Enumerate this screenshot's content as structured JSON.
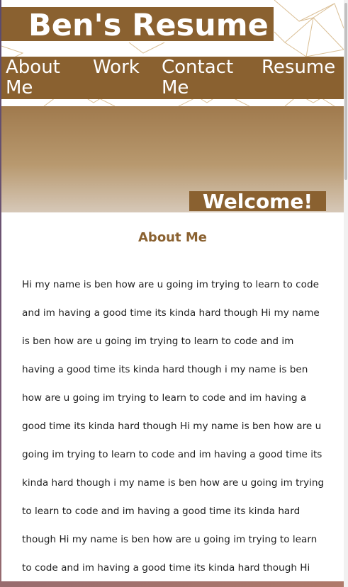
{
  "header": {
    "title": "Ben's Resume"
  },
  "nav": {
    "items": [
      {
        "label": "About Me"
      },
      {
        "label": "Work"
      },
      {
        "label": "Contact Me"
      },
      {
        "label": "Resume"
      }
    ]
  },
  "hero": {
    "welcome": "Welcome!"
  },
  "about": {
    "title": "About Me",
    "body": "Hi my name is ben how are u going im trying to learn to code and im having a good time its kinda hard though Hi my name is ben how are u going im trying to learn to code and im having a good time its kinda hard though i my name is ben how are u going im trying to learn to code and im having a good time its kinda hard though Hi my name is ben how are u going im trying to learn to code and im having a good time its kinda hard though i my name is ben how are u going im trying to learn to code and im having a good time its kinda hard though Hi my name is ben how are u going im trying to learn to code and im having a good time its kinda hard though Hi my name is ben how are u going im"
  },
  "colors": {
    "brand": "#8a6130",
    "pattern_line": "#d4b483"
  }
}
